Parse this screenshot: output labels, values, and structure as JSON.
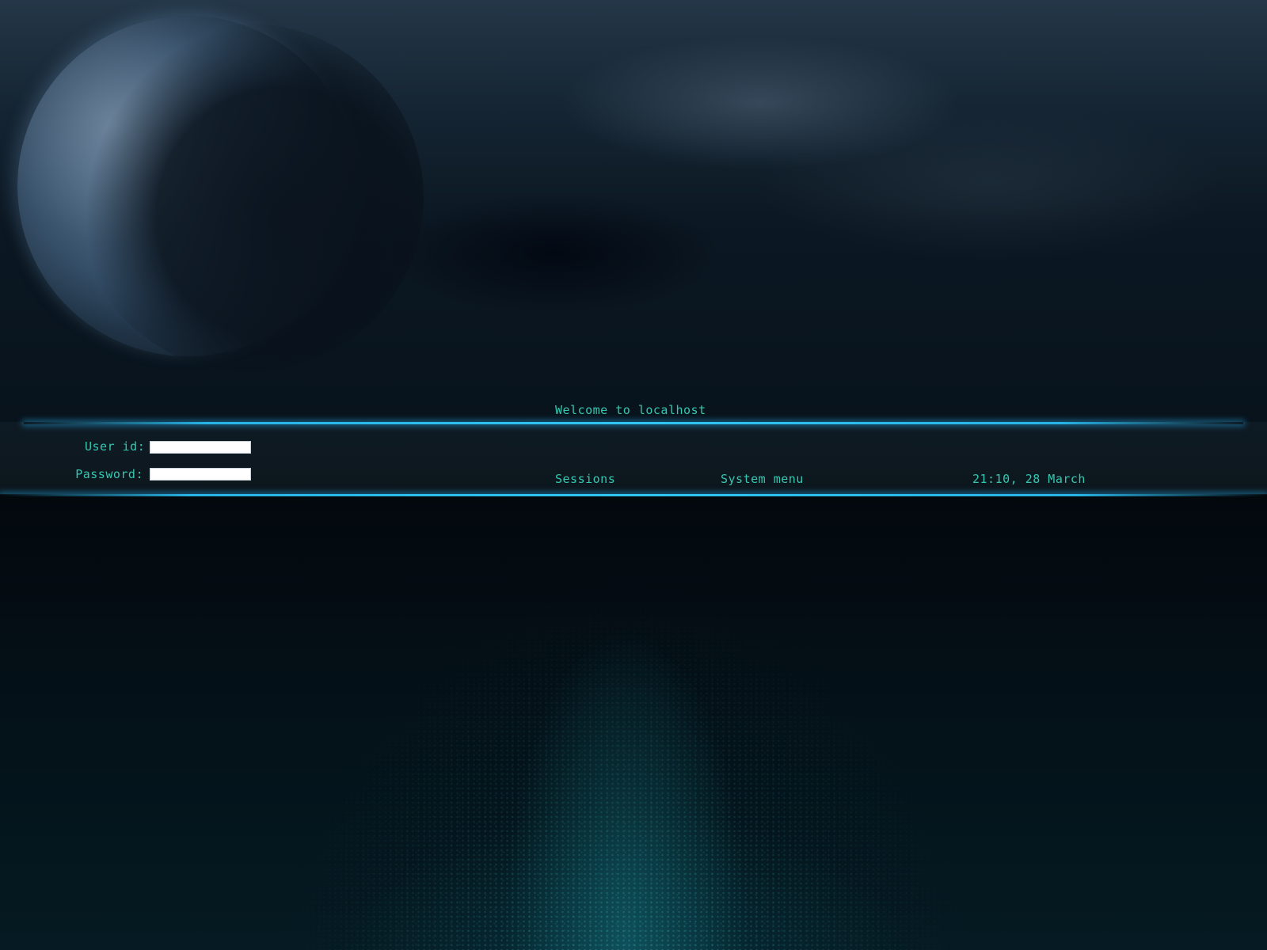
{
  "greeter": {
    "welcome": "Welcome to localhost",
    "user_label": "User id:",
    "user_value": "",
    "password_label": "Password:",
    "password_value": ""
  },
  "menu": {
    "sessions": "Sessions",
    "system_menu": "System menu"
  },
  "clock": {
    "text": "21:10, 28 March"
  },
  "colors": {
    "text_accent": "#34c7b1",
    "glow_line": "#27b4e6"
  }
}
